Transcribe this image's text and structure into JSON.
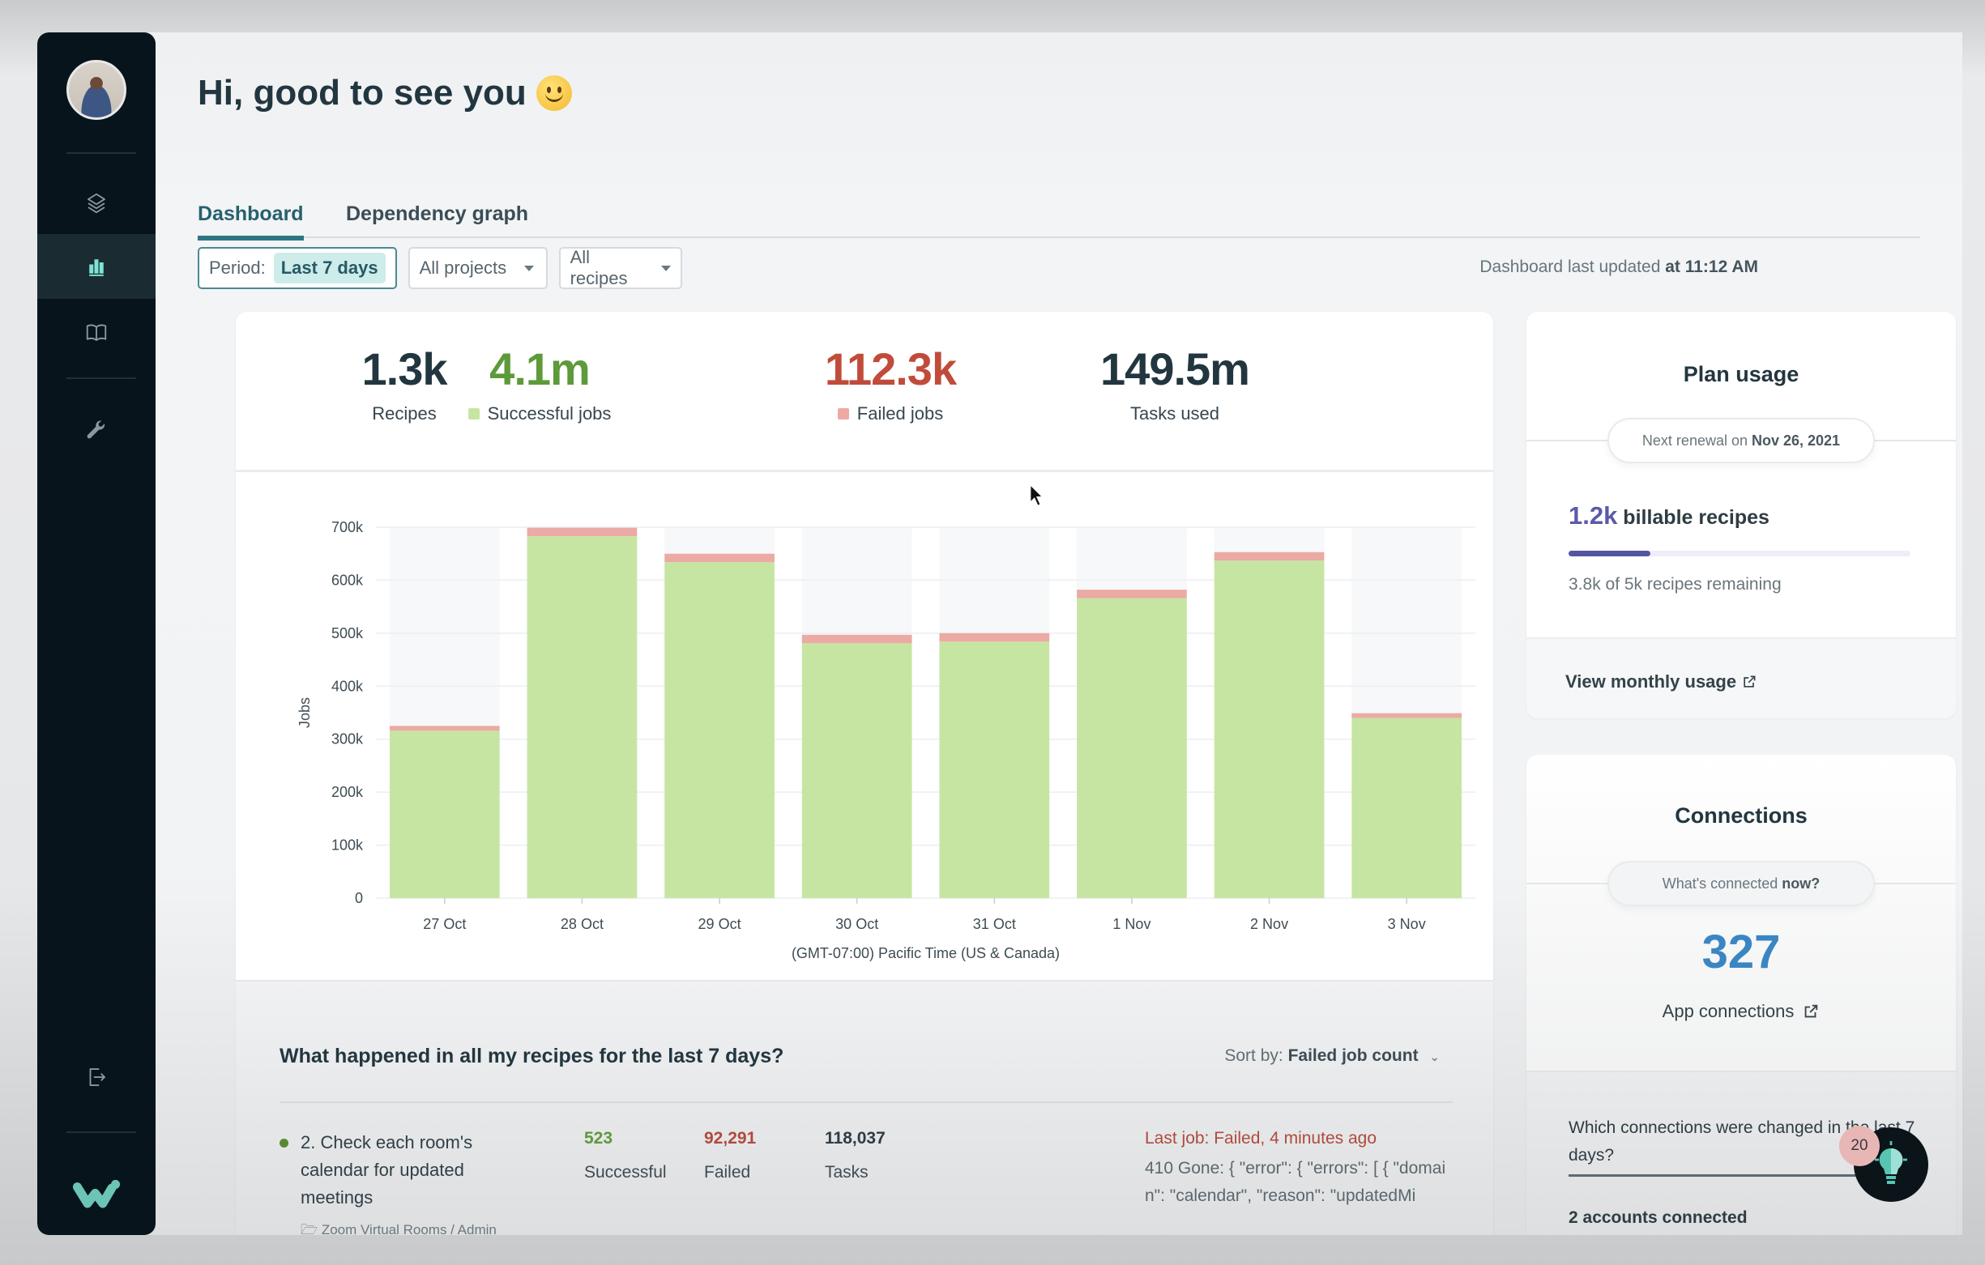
{
  "sidebar": {
    "items": [
      {
        "name": "projects",
        "icon": "layers-icon",
        "active": false
      },
      {
        "name": "dashboard",
        "icon": "bar-chart-icon",
        "active": true
      },
      {
        "name": "docs",
        "icon": "book-icon",
        "active": false
      },
      {
        "name": "tools",
        "icon": "wrench-icon",
        "active": false
      }
    ],
    "logout_icon": "logout-icon",
    "logo_icon": "workato-logo-icon"
  },
  "header": {
    "greeting": "Hi, good to see you",
    "emoji": "slightly-smiling-face"
  },
  "tabs": [
    {
      "label": "Dashboard",
      "active": true
    },
    {
      "label": "Dependency graph",
      "active": false
    }
  ],
  "filters": {
    "period_label": "Period:",
    "period_value": "Last 7 days",
    "projects": "All projects",
    "recipes": "All recipes"
  },
  "updated": {
    "prefix": "Dashboard last updated",
    "time": "at 11:12 AM"
  },
  "stats": [
    {
      "value": "1.3k",
      "label": "Recipes",
      "color": "#22363f",
      "swatch": null
    },
    {
      "value": "4.1m",
      "label": "Successful jobs",
      "color": "#5d9a3a",
      "swatch": "#c6e5a3"
    },
    {
      "value": "112.3k",
      "label": "Failed jobs",
      "color": "#c14b3a",
      "swatch": "#edaaa4"
    },
    {
      "value": "149.5m",
      "label": "Tasks used",
      "color": "#22363f",
      "swatch": null
    }
  ],
  "chart_data": {
    "type": "bar",
    "stacked": true,
    "categories": [
      "27 Oct",
      "28 Oct",
      "29 Oct",
      "30 Oct",
      "31 Oct",
      "1 Nov",
      "2 Nov",
      "3 Nov"
    ],
    "series": [
      {
        "name": "Successful jobs",
        "color": "#c6e5a3",
        "values": [
          316000,
          683000,
          634000,
          481000,
          484000,
          566000,
          637000,
          340000
        ]
      },
      {
        "name": "Failed jobs",
        "color": "#ebaaa3",
        "values": [
          9000,
          16000,
          16000,
          16000,
          16000,
          16000,
          16000,
          9000
        ]
      }
    ],
    "title": "",
    "xlabel": "(GMT-07:00) Pacific Time (US & Canada)",
    "ylabel": "Jobs",
    "ylim": [
      0,
      700000
    ],
    "yticks": [
      0,
      100000,
      200000,
      300000,
      400000,
      500000,
      600000,
      700000
    ],
    "ytick_labels": [
      "0",
      "100k",
      "200k",
      "300k",
      "400k",
      "500k",
      "600k",
      "700k"
    ],
    "grid": true,
    "legend": "none"
  },
  "recipes_section": {
    "title": "What happened in all my recipes for the last 7 days?",
    "sort_label": "Sort by:",
    "sort_value": "Failed job count",
    "rows": [
      {
        "name": "2. Check each room's calendar for updated meetings",
        "folder": "Zoom Virtual Rooms / Admin",
        "successful": "523",
        "successful_label": "Successful",
        "failed": "92,291",
        "failed_label": "Failed",
        "tasks": "118,037",
        "tasks_label": "Tasks",
        "last_job": "Last job: Failed, 4 minutes ago",
        "error": "410 Gone: { \"error\": { \"errors\": [ { \"domain\": \"calendar\", \"reason\": \"updatedMi"
      }
    ]
  },
  "plan_usage": {
    "title": "Plan usage",
    "renewal_prefix": "Next renewal on",
    "renewal_date": "Nov 26, 2021",
    "billable_value": "1.2k",
    "billable_label": "billable recipes",
    "usage_fraction": 0.24,
    "remaining": "3.8k of 5k recipes remaining",
    "link": "View monthly usage"
  },
  "connections": {
    "title": "Connections",
    "pill_prefix": "What's connected",
    "pill_bold": "now?",
    "count": "327",
    "count_label": "App connections",
    "question": "Which connections were changed in the last 7 days?",
    "accounts": "2 accounts connected"
  },
  "help": {
    "badge": "20",
    "icon": "lightbulb-icon"
  }
}
